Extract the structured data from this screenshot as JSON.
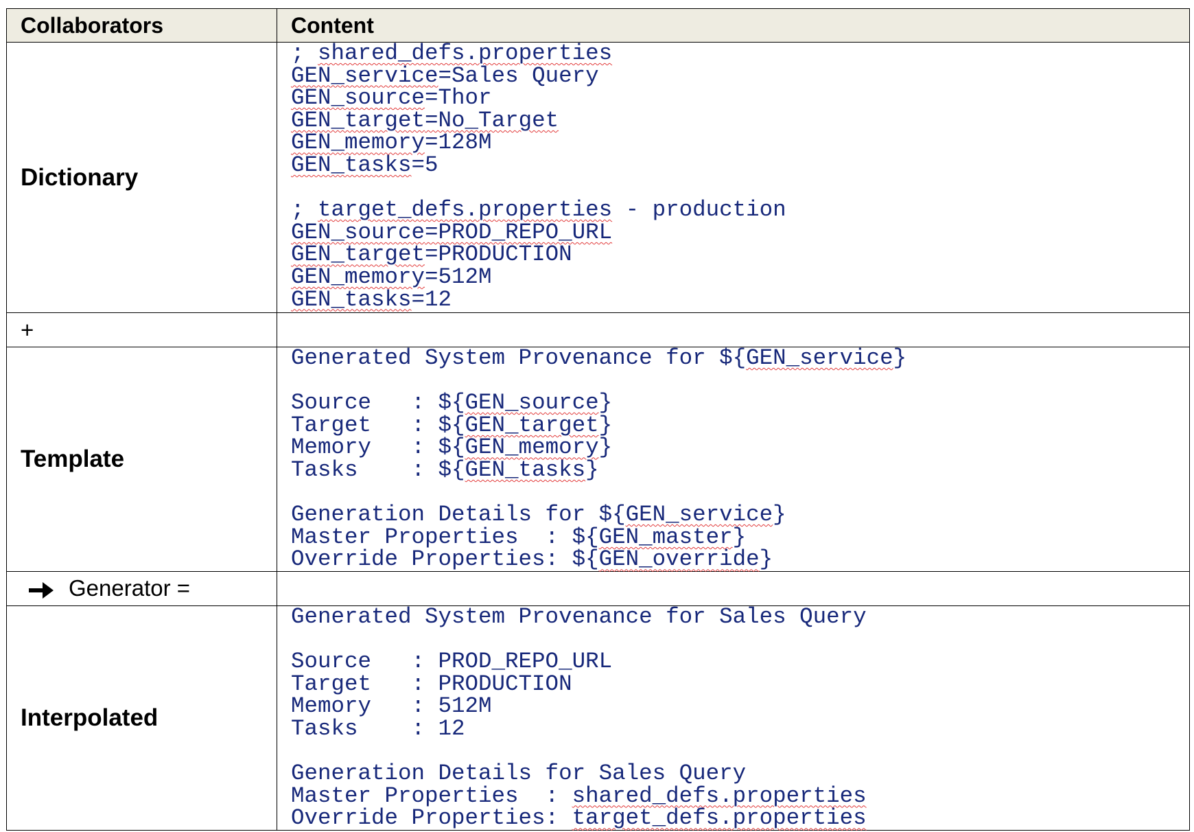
{
  "header": {
    "col1": "Collaborators",
    "col2": "Content"
  },
  "rows": {
    "dictionary": {
      "label": "Dictionary",
      "shared_comment_prefix": "; ",
      "shared_file": "shared_defs.properties",
      "shared_lines": [
        {
          "key": "GEN_service",
          "value": "=Sales Query"
        },
        {
          "key": "GEN_source",
          "value": "=Thor"
        },
        {
          "key": "GEN_target",
          "value": "=No_Target"
        },
        {
          "key": "GEN_memory",
          "value": "=128M"
        },
        {
          "key": "GEN_tasks",
          "value": "=5"
        }
      ],
      "target_comment_prefix": "; ",
      "target_file": "target_defs.properties",
      "target_comment_suffix": " - production",
      "target_lines": [
        {
          "key": "GEN_source",
          "value": "=PROD_REPO_URL"
        },
        {
          "key": "GEN_target",
          "value": "=PRODUCTION"
        },
        {
          "key": "GEN_memory",
          "value": "=512M"
        },
        {
          "key": "GEN_tasks",
          "value": "=12"
        }
      ]
    },
    "plus": {
      "label": "+"
    },
    "template": {
      "label": "Template",
      "line1_prefix": "Generated System Provenance for ${",
      "line1_var": "GEN_service",
      "line1_suffix": "}",
      "fields": [
        {
          "prefix": "Source   : ${",
          "var": "GEN_source",
          "suffix": "}"
        },
        {
          "prefix": "Target   : ${",
          "var": "GEN_target",
          "suffix": "}"
        },
        {
          "prefix": "Memory   : ${",
          "var": "GEN_memory",
          "suffix": "}"
        },
        {
          "prefix": "Tasks    : ${",
          "var": "GEN_tasks",
          "suffix": "}"
        }
      ],
      "details_prefix": "Generation Details for ${",
      "details_var": "GEN_service",
      "details_suffix": "}",
      "master_prefix": "Master Properties  : ${",
      "master_var": "GEN_master",
      "master_suffix": "}",
      "override_prefix": "Override Properties: ${",
      "override_var": "GEN_override",
      "override_suffix": "}"
    },
    "generator": {
      "label": "Generator =",
      "icon": "right-arrow-icon"
    },
    "interpolated": {
      "label": "Interpolated",
      "line1": "Generated System Provenance for Sales Query",
      "fields": [
        "Source   : PROD_REPO_URL",
        "Target   : PRODUCTION",
        "Memory   : 512M",
        "Tasks    : 12"
      ],
      "details": "Generation Details for Sales Query",
      "master_prefix": "Master Properties  : ",
      "master_value": "shared_defs.properties",
      "override_prefix": "Override Properties: ",
      "override_value": "target_defs.properties"
    }
  },
  "colors": {
    "header_bg": "#eeece1",
    "code_text": "#17287a",
    "spellcheck_underline": "#e23b3b"
  }
}
